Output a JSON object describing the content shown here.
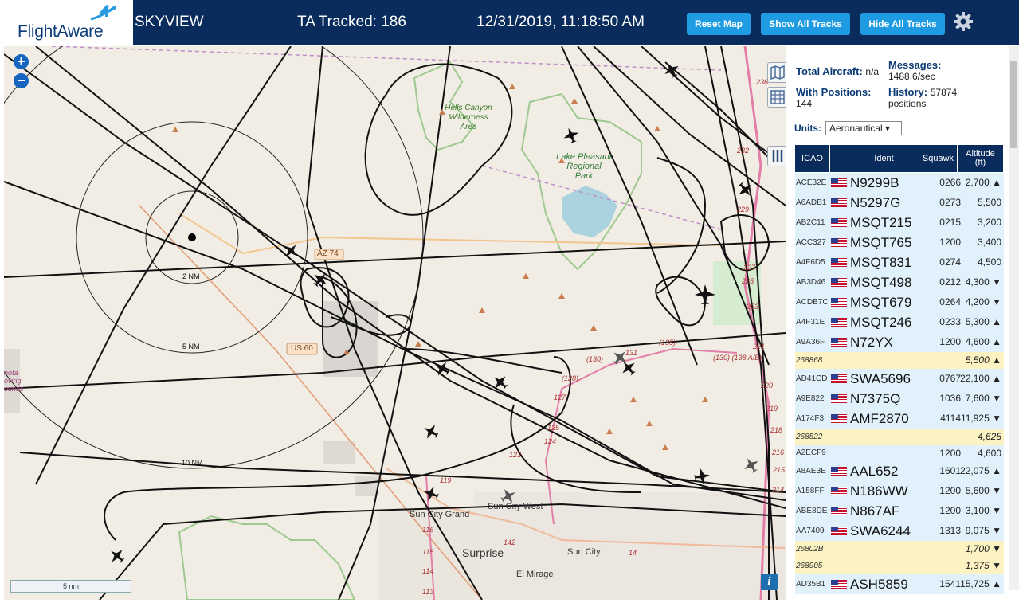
{
  "header": {
    "brand": "FlightAware",
    "site_name": "SKYVIEW",
    "tracked": "TA Tracked: 186",
    "datetime": "12/31/2019, 11:18:50 AM",
    "buttons": {
      "reset": "Reset Map",
      "show": "Show All Tracks",
      "hide": "Hide All Tracks"
    },
    "settings_icon": "gear-icon",
    "colors": {
      "bar": "#0a2c5c",
      "button": "#1e9be2"
    }
  },
  "map": {
    "zoom_in": "+",
    "zoom_out": "−",
    "scale": "5 nm",
    "info": "i",
    "labels": {
      "hells_canyon": [
        "Hells Canyon",
        "Wilderness",
        "Area"
      ],
      "lake_pleasant": [
        "Lake Pleasant",
        "Regional",
        "Park"
      ],
      "ring_2": "2 NM",
      "ring_5": "5 NM",
      "ring_10": "10 NM",
      "az74": "AZ 74",
      "us60": "US 60",
      "sun_city_grand": "Sun City Grand",
      "sun_city_west": "Sun City West",
      "surprise": "Surprise",
      "sun_city": "Sun City",
      "el_mirage": "El Mirage",
      "route_130": "(130)",
      "route_135": "(135)",
      "route_130_138": "(130) (138 A/B)",
      "route_128": "(128)",
      "m_127": "127",
      "m_125": "125",
      "m_124": "124",
      "m_123": "123",
      "m_119": "119",
      "m_116": "116",
      "m_115": "115",
      "m_114": "114",
      "m_113": "113",
      "m_142": "142",
      "m_14": "14",
      "m_131": "131",
      "m_236": "236",
      "m_232": "232",
      "m_229": "229",
      "m_227": "227",
      "m_225": "225",
      "m_223": "223",
      "m_221": "221",
      "m_220": "220",
      "m_219": "219",
      "m_218": "218",
      "m_216": "216",
      "m_215": "215",
      "m_214": "214",
      "edge_left": [
        "nota",
        "oving",
        "ounds"
      ]
    }
  },
  "panel": {
    "total_aircraft_label": "Total Aircraft:",
    "total_aircraft": "n/a",
    "messages_label": "Messages:",
    "messages": "1488.6/sec",
    "with_positions_label": "With Positions:",
    "with_positions": "144",
    "history_label": "History:",
    "history": "57874",
    "history_unit": "positions",
    "units_label": "Units:",
    "units_value": "Aeronautical ▾",
    "columns": {
      "icao": "ICAO",
      "ident": "Ident",
      "squawk": "Squawk",
      "altitude": "Altitude (ft)"
    },
    "rows": [
      {
        "icao": "ACE32E",
        "ident": "N9299B",
        "squawk": "0266",
        "alt": "2,700 ▲",
        "flag": true,
        "yellow": false
      },
      {
        "icao": "A6ADB1",
        "ident": "N5297G",
        "squawk": "0273",
        "alt": "5,500",
        "flag": true,
        "yellow": false
      },
      {
        "icao": "AB2C11",
        "ident": "MSQT215",
        "squawk": "0215",
        "alt": "3,200",
        "flag": true,
        "yellow": false
      },
      {
        "icao": "ACC327",
        "ident": "MSQT765",
        "squawk": "1200",
        "alt": "3,400",
        "flag": true,
        "yellow": false
      },
      {
        "icao": "A4F6D5",
        "ident": "MSQT831",
        "squawk": "0274",
        "alt": "4,500",
        "flag": true,
        "yellow": false
      },
      {
        "icao": "AB3D46",
        "ident": "MSQT498",
        "squawk": "0212",
        "alt": "4,300 ▼",
        "flag": true,
        "yellow": false
      },
      {
        "icao": "ACDB7C",
        "ident": "MSQT679",
        "squawk": "0264",
        "alt": "4,200 ▼",
        "flag": true,
        "yellow": false
      },
      {
        "icao": "A4F31E",
        "ident": "MSQT246",
        "squawk": "0233",
        "alt": "5,300 ▲",
        "flag": true,
        "yellow": false
      },
      {
        "icao": "A9A36F",
        "ident": "N72YX",
        "squawk": "1200",
        "alt": "4,600 ▲",
        "flag": true,
        "yellow": false
      },
      {
        "icao": "268868",
        "ident": "",
        "squawk": "",
        "alt": "5,500 ▲",
        "flag": false,
        "yellow": true
      },
      {
        "icao": "AD41CD",
        "ident": "SWA5696",
        "squawk": "0767",
        "alt": "22,100 ▲",
        "flag": true,
        "yellow": false
      },
      {
        "icao": "A9E822",
        "ident": "N7375Q",
        "squawk": "1036",
        "alt": "7,600 ▼",
        "flag": true,
        "yellow": false
      },
      {
        "icao": "A174F3",
        "ident": "AMF2870",
        "squawk": "4114",
        "alt": "11,925 ▼",
        "flag": true,
        "yellow": false
      },
      {
        "icao": "268522",
        "ident": "",
        "squawk": "",
        "alt": "4,625",
        "flag": false,
        "yellow": true
      },
      {
        "icao": "A2ECF9",
        "ident": "",
        "squawk": "1200",
        "alt": "4,600",
        "flag": false,
        "yellow": false,
        "short": true
      },
      {
        "icao": "A8AE3E",
        "ident": "AAL652",
        "squawk": "1601",
        "alt": "22,075 ▲",
        "flag": true,
        "yellow": false
      },
      {
        "icao": "A158FF",
        "ident": "N186WW",
        "squawk": "1200",
        "alt": "5,600 ▼",
        "flag": true,
        "yellow": false
      },
      {
        "icao": "ABE8DE",
        "ident": "N867AF",
        "squawk": "1200",
        "alt": "3,100 ▼",
        "flag": true,
        "yellow": false
      },
      {
        "icao": "AA7409",
        "ident": "SWA6244",
        "squawk": "1313",
        "alt": "9,075 ▼",
        "flag": true,
        "yellow": false
      },
      {
        "icao": "26802B",
        "ident": "",
        "squawk": "",
        "alt": "1,700 ▼",
        "flag": false,
        "yellow": true
      },
      {
        "icao": "268905",
        "ident": "",
        "squawk": "",
        "alt": "1,375 ▼",
        "flag": false,
        "yellow": true
      },
      {
        "icao": "AD35B1",
        "ident": "ASH5859",
        "squawk": "1541",
        "alt": "15,725 ▲",
        "flag": true,
        "yellow": false
      }
    ]
  }
}
